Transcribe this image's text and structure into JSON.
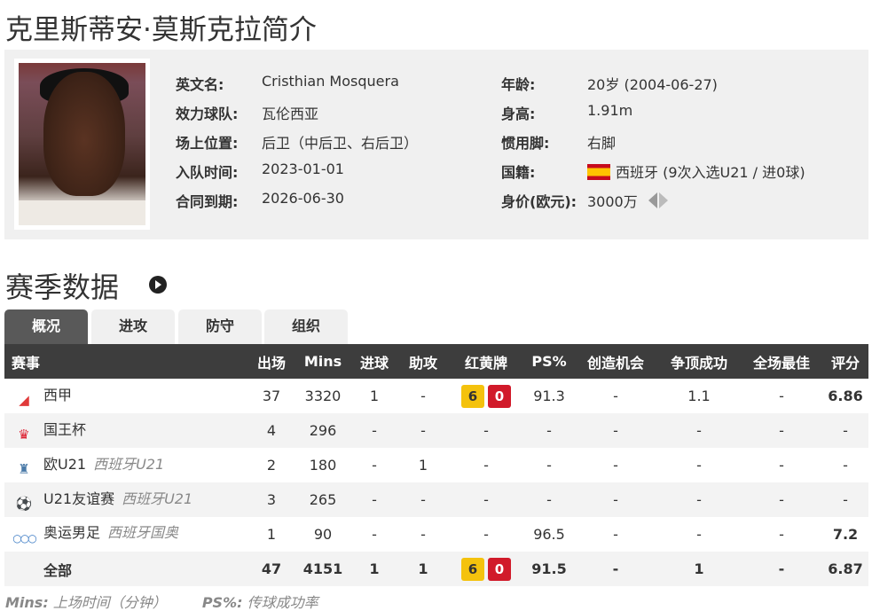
{
  "page_title": "克里斯蒂安·莫斯克拉简介",
  "profile": {
    "left": [
      {
        "label": "英文名:",
        "value": "Cristhian Mosquera"
      },
      {
        "label": "效力球队:",
        "value": "瓦伦西亚"
      },
      {
        "label": "场上位置:",
        "value": "后卫（中后卫、右后卫）"
      },
      {
        "label": "入队时间:",
        "value": "2023-01-01"
      },
      {
        "label": "合同到期:",
        "value": "2026-06-30"
      }
    ],
    "right": [
      {
        "label": "年龄:",
        "value": "20岁  (2004-06-27)"
      },
      {
        "label": "身高:",
        "value": "1.91m"
      },
      {
        "label": "惯用脚:",
        "value": "右脚"
      },
      {
        "label": "国籍:",
        "value": "西班牙 (9次入选U21 / 进0球)"
      },
      {
        "label": "身价(欧元):",
        "value": "3000万"
      }
    ],
    "nationality_flag": "spain-flag"
  },
  "section": {
    "title": "赛季数据",
    "icon": "arrow-circle-right-icon",
    "tabs": [
      "概况",
      "进攻",
      "防守",
      "组织"
    ],
    "active_tab": 0
  },
  "table": {
    "headers": [
      "赛事",
      "出场",
      "Mins",
      "进球",
      "助攻",
      "红黄牌",
      "PS%",
      "创造机会",
      "争顶成功",
      "全场最佳",
      "评分"
    ],
    "rows": [
      {
        "icon": "laliga-icon",
        "glyph": "◢",
        "competition": "西甲",
        "team": "",
        "apps": "37",
        "mins": "3320",
        "goals": "1",
        "assists": "-",
        "yellow": "6",
        "red": "0",
        "ps": "91.3",
        "chances": "-",
        "aerials": "1.1",
        "motm": "-",
        "rating": "6.86"
      },
      {
        "icon": "copa-del-rey-icon",
        "glyph": "♛",
        "competition": "国王杯",
        "team": "",
        "apps": "4",
        "mins": "296",
        "goals": "-",
        "assists": "-",
        "yellow": "",
        "red": "",
        "cards_text": "-",
        "ps": "-",
        "chances": "-",
        "aerials": "-",
        "motm": "-",
        "rating": "-"
      },
      {
        "icon": "euro-u21-icon",
        "glyph": "♜",
        "competition": "欧U21",
        "team": "西班牙U21",
        "apps": "2",
        "mins": "180",
        "goals": "-",
        "assists": "1",
        "yellow": "",
        "red": "",
        "cards_text": "-",
        "ps": "-",
        "chances": "-",
        "aerials": "-",
        "motm": "-",
        "rating": "-"
      },
      {
        "icon": "u21-friendly-icon",
        "glyph": "⚽",
        "competition": "U21友谊赛",
        "team": "西班牙U21",
        "apps": "3",
        "mins": "265",
        "goals": "-",
        "assists": "-",
        "yellow": "",
        "red": "",
        "cards_text": "-",
        "ps": "-",
        "chances": "-",
        "aerials": "-",
        "motm": "-",
        "rating": "-"
      },
      {
        "icon": "olympic-rings-icon",
        "glyph": "○○○",
        "competition": "奥运男足",
        "team": "西班牙国奥",
        "apps": "1",
        "mins": "90",
        "goals": "-",
        "assists": "-",
        "yellow": "",
        "red": "",
        "cards_text": "-",
        "ps": "96.5",
        "chances": "-",
        "aerials": "-",
        "motm": "-",
        "rating": "7.2"
      }
    ],
    "total": {
      "competition": "全部",
      "apps": "47",
      "mins": "4151",
      "goals": "1",
      "assists": "1",
      "yellow": "6",
      "red": "0",
      "ps": "91.5",
      "chances": "-",
      "aerials": "1",
      "motm": "-",
      "rating": "6.87"
    }
  },
  "footnote": {
    "mins_key": "Mins:",
    "mins_desc": " 上场时间（分钟）",
    "ps_key": "PS%:",
    "ps_desc": " 传球成功率"
  }
}
